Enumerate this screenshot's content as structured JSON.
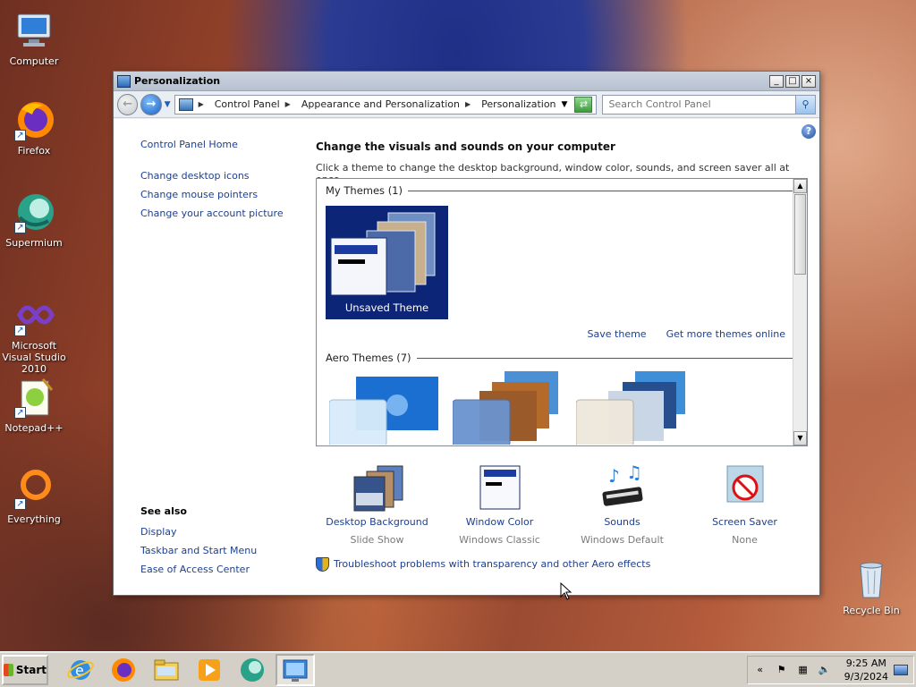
{
  "desktop": {
    "icons": [
      {
        "label": "Computer"
      },
      {
        "label": "Firefox"
      },
      {
        "label": "Supermium"
      },
      {
        "label": "Microsoft Visual Studio 2010"
      },
      {
        "label": "Notepad++"
      },
      {
        "label": "Everything"
      },
      {
        "label": "Recycle Bin"
      }
    ]
  },
  "window": {
    "title": "Personalization",
    "caption_buttons": {
      "minimize": "_",
      "maximize": "□",
      "close": "×"
    },
    "breadcrumb": [
      "Control Panel",
      "Appearance and Personalization",
      "Personalization"
    ],
    "search_placeholder": "Search Control Panel",
    "left_pane": {
      "home": "Control Panel Home",
      "links": [
        "Change desktop icons",
        "Change mouse pointers",
        "Change your account picture"
      ],
      "see_also_title": "See also",
      "see_also": [
        "Display",
        "Taskbar and Start Menu",
        "Ease of Access Center"
      ]
    },
    "main": {
      "heading": "Change the visuals and sounds on your computer",
      "subtitle": "Click a theme to change the desktop background, window color, sounds, and screen saver all at once.",
      "my_themes_label": "My Themes (1)",
      "unsaved_theme": "Unsaved Theme",
      "save_theme": "Save theme",
      "get_more": "Get more themes online",
      "aero_themes_label": "Aero Themes (7)"
    },
    "settings": [
      {
        "label": "Desktop Background",
        "value": "Slide Show"
      },
      {
        "label": "Window Color",
        "value": "Windows Classic"
      },
      {
        "label": "Sounds",
        "value": "Windows Default"
      },
      {
        "label": "Screen Saver",
        "value": "None"
      }
    ],
    "troubleshoot": "Troubleshoot problems with transparency and other Aero effects"
  },
  "taskbar": {
    "start_label": "Start",
    "clock_time": "9:25 AM",
    "clock_date": "9/3/2024"
  }
}
